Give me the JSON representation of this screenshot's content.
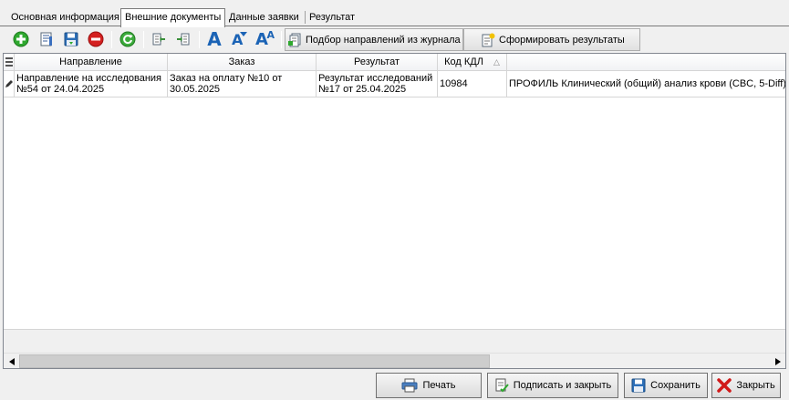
{
  "tabs": [
    {
      "label": "Основная информация",
      "active": false
    },
    {
      "label": "Внешние документы",
      "active": true
    },
    {
      "label": "Данные заявки",
      "active": false
    },
    {
      "label": "Результат",
      "active": false
    }
  ],
  "toolbar": {
    "icons": [
      "add-icon",
      "edit-document-icon",
      "save-icon",
      "delete-icon",
      "refresh-icon",
      "move-left-icon",
      "move-right-icon",
      "font-default-icon",
      "font-smaller-icon",
      "font-larger-icon"
    ],
    "font_buttons": {
      "a1": "A",
      "a2": "A",
      "a3": "A"
    },
    "select_referrals_label": "Подбор направлений из журнала",
    "form_results_label": "Сформировать результаты"
  },
  "grid": {
    "columns": [
      {
        "key": "indicator",
        "label": ""
      },
      {
        "key": "referral",
        "label": "Направление"
      },
      {
        "key": "order",
        "label": "Заказ"
      },
      {
        "key": "result",
        "label": "Результат"
      },
      {
        "key": "kdl_code",
        "label": "Код КДЛ",
        "sort": "ascending"
      },
      {
        "key": "service",
        "label": ""
      }
    ],
    "rows": [
      {
        "referral": "Направление на исследования №54 от 24.04.2025",
        "order": "Заказ на оплату №10 от 30.05.2025",
        "result": "Результат исследований №17 от 25.04.2025",
        "kdl_code": "10984",
        "service": "ПРОФИЛЬ Клинический (общий) анализ крови (CBC, 5-Diff)"
      }
    ]
  },
  "buttons": {
    "print": "Печать",
    "sign_close": "Подписать и закрыть",
    "save": "Сохранить",
    "close": "Закрыть"
  },
  "colors": {
    "accent_blue": "#1b63b5",
    "add_green": "#2fa82f",
    "delete_red": "#d42020",
    "close_red": "#d11a1a"
  }
}
